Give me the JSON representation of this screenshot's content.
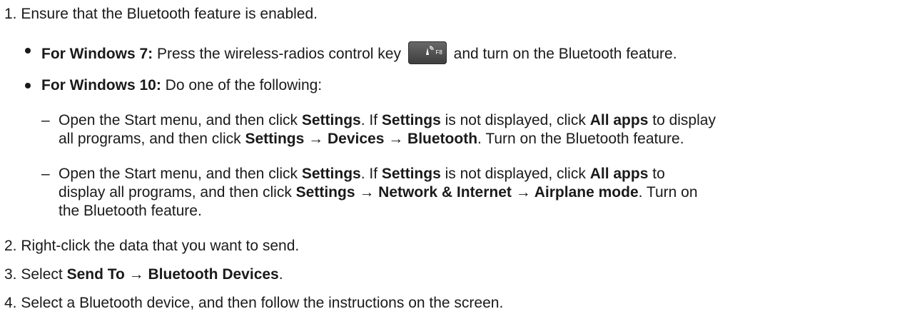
{
  "steps": {
    "s1": {
      "num": "1.",
      "text": "Ensure that the Bluetooth feature is enabled."
    },
    "win7": {
      "label": "For Windows 7:",
      "text_before": "Press the wireless-radios control key",
      "key_label": "F8",
      "key_icon": "wireless-radios-icon",
      "text_after": "and turn on the Bluetooth feature."
    },
    "win10": {
      "label": "For Windows 10:",
      "text": "Do one of the following:"
    },
    "opt1": {
      "dash": "–",
      "a1": "Open the Start menu, and then click",
      "a2": "Settings",
      "a3": ". If",
      "a4": "Settings",
      "a5": "is not displayed, click",
      "a6": "All apps",
      "a7": "to display",
      "b1": "all programs, and then click",
      "b2": "Settings → Devices → Bluetooth",
      "b3": ". Turn on the Bluetooth feature."
    },
    "opt2": {
      "dash": "–",
      "a1": "Open the Start menu, and then click",
      "a2": "Settings",
      "a3": ". If",
      "a4": "Settings",
      "a5": "is not displayed, click",
      "a6": "All apps",
      "a7": "to",
      "b1": "display all programs, and then click",
      "b2": "Settings → Network & Internet → Airplane mode",
      "b3": ". Turn on",
      "c1": "the Bluetooth feature."
    },
    "s2": {
      "num": "2.",
      "text": "Right-click the data that you want to send."
    },
    "s3": {
      "num": "3.",
      "text1": "Select",
      "bold": "Send To → Bluetooth Devices",
      "text2": "."
    },
    "s4": {
      "num": "4.",
      "text": "Select a Bluetooth device, and then follow the instructions on the screen."
    }
  }
}
